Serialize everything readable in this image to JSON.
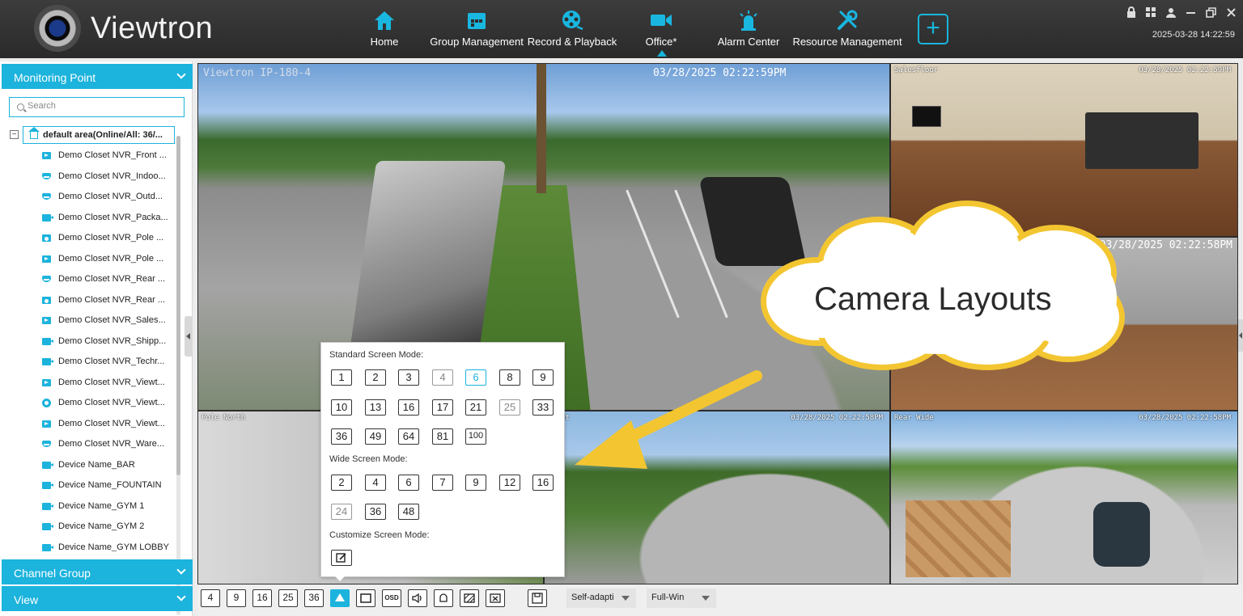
{
  "app": {
    "brand": "Viewtron",
    "clock": "2025-03-28 14:22:59"
  },
  "nav": [
    {
      "label": "Home",
      "icon": "home-icon"
    },
    {
      "label": "Group Management",
      "icon": "group-management-icon"
    },
    {
      "label": "Record & Playback",
      "icon": "film-reel-icon"
    },
    {
      "label": "Office*",
      "icon": "video-camera-icon",
      "active": true
    },
    {
      "label": "Alarm Center",
      "icon": "alarm-center-icon"
    },
    {
      "label": "Resource Management",
      "icon": "tools-icon"
    }
  ],
  "sidebar": {
    "monitoring_point": "Monitoring Point",
    "search_placeholder": "Search",
    "root": "default area(Online/All: 36/...",
    "items": [
      "Demo Closet NVR_Front ...",
      "Demo Closet NVR_Indoo...",
      "Demo Closet NVR_Outd...",
      "Demo Closet NVR_Packa...",
      "Demo Closet NVR_Pole ...",
      "Demo Closet NVR_Pole ...",
      "Demo Closet NVR_Rear ...",
      "Demo Closet NVR_Rear ...",
      "Demo Closet NVR_Sales...",
      "Demo Closet NVR_Shipp...",
      "Demo Closet NVR_Techr...",
      "Demo Closet NVR_Viewt...",
      "Demo Closet NVR_Viewt...",
      "Demo Closet NVR_Viewt...",
      "Demo Closet NVR_Ware...",
      "Device Name_BAR",
      "Device Name_FOUNTAIN",
      "Device Name_GYM 1",
      "Device Name_GYM 2",
      "Device Name_GYM LOBBY"
    ],
    "channel_group": "Channel Group",
    "view": "View"
  },
  "video": {
    "main_label": "Viewtron IP-180-4",
    "main_time": "03/28/2025 02:22:59PM",
    "office_label": "Salesfloor",
    "office_time": "03/28/2025 02:22:59PM",
    "lot_time": "03/28/2025 02:22:58PM",
    "pole_label": "Pole North",
    "back_label": "Front",
    "back_time": "03/28/2025 02:22:58PM",
    "rear_label": "Rear Wide",
    "rear_time": "03/28/2025 02:22:58PM"
  },
  "callout": {
    "text": "Camera Layouts",
    "color": "#f3c631"
  },
  "mode_popup": {
    "standard_title": "Standard Screen Mode:",
    "standard_row1": [
      "1",
      "2",
      "3",
      "4",
      "6",
      "8",
      "9"
    ],
    "standard_row2": [
      "10",
      "13",
      "16",
      "17",
      "21",
      "25",
      "33"
    ],
    "standard_row3": [
      "36",
      "49",
      "64",
      "81",
      "100"
    ],
    "selected": "6",
    "wide_title": "Wide Screen Mode:",
    "wide_row1": [
      "2",
      "4",
      "6",
      "7",
      "9",
      "12",
      "16"
    ],
    "wide_row2": [
      "24",
      "36",
      "48"
    ],
    "custom_title": "Customize Screen Mode:"
  },
  "toolbar": {
    "layout_buttons": [
      "4",
      "9",
      "16",
      "25",
      "36"
    ],
    "osd": "OSD",
    "ratio_select": "Self-adapti",
    "window_select": "Full-Win"
  },
  "colors": {
    "accent": "#1cb3dd",
    "topbar": "#333333"
  }
}
